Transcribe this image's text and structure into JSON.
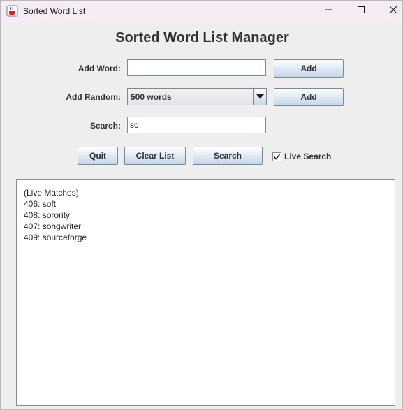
{
  "window": {
    "title": "Sorted Word List",
    "app_icon": "java-cup-icon",
    "controls": [
      "minimize-icon",
      "maximize-icon",
      "close-icon"
    ]
  },
  "heading": "Sorted Word List Manager",
  "add_word": {
    "label": "Add Word:",
    "value": "",
    "button_label": "Add"
  },
  "add_random": {
    "label": "Add Random:",
    "selected": "500 words",
    "button_label": "Add"
  },
  "search": {
    "label": "Search:",
    "value": "so"
  },
  "actions": {
    "quit_label": "Quit",
    "clear_label": "Clear List",
    "search_label": "Search",
    "live_search_label": "Live Search",
    "live_search_checked": true
  },
  "output": {
    "header": "(Live Matches)",
    "lines": [
      "406: soft",
      "408: sorority",
      "407: songwriter",
      "409: sourceforge"
    ]
  },
  "colors": {
    "titlebar": "#f4ecf2",
    "window_bg": "#eeeeee",
    "button_gradient_end": "#c6d6e8"
  }
}
